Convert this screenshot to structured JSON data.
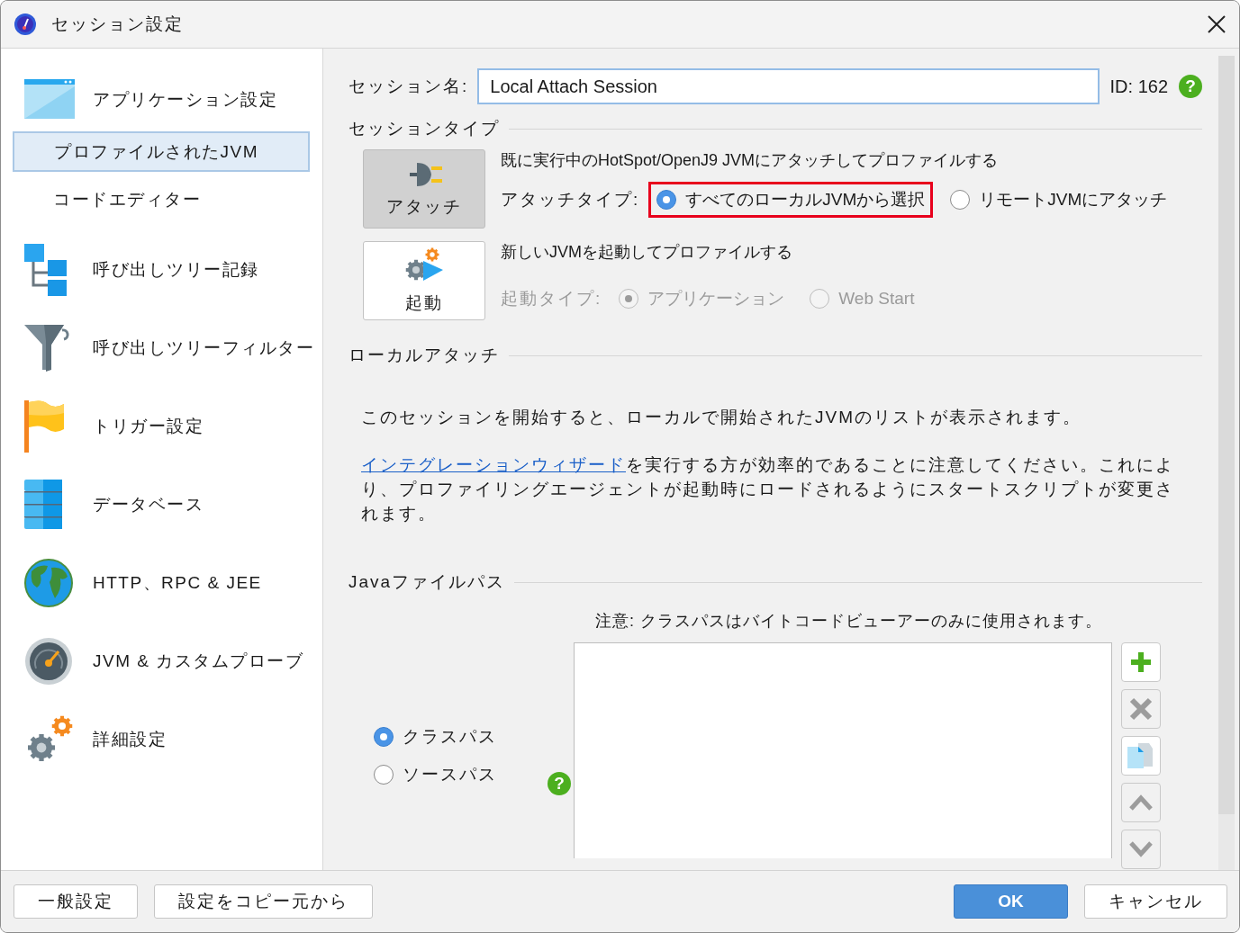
{
  "window": {
    "title": "セッション設定"
  },
  "sidebar": {
    "items": [
      {
        "label": "アプリケーション設定",
        "selected": false,
        "children": [
          {
            "label": "プロファイルされたJVM",
            "selected": true
          },
          {
            "label": "コードエディター",
            "selected": false
          }
        ]
      },
      {
        "label": "呼び出しツリー記録",
        "selected": false
      },
      {
        "label": "呼び出しツリーフィルター",
        "selected": false
      },
      {
        "label": "トリガー設定",
        "selected": false
      },
      {
        "label": "データベース",
        "selected": false
      },
      {
        "label": "HTTP、RPC & JEE",
        "selected": false
      },
      {
        "label": "JVM & カスタムプローブ",
        "selected": false
      },
      {
        "label": "詳細設定",
        "selected": false
      }
    ]
  },
  "session": {
    "name_label": "セッション名:",
    "name_value": "Local Attach Session",
    "id_label": "ID:",
    "id_value": "162",
    "help": "?"
  },
  "session_type": {
    "heading": "セッションタイプ",
    "modes": [
      {
        "kind": "attach",
        "label": "アタッチ",
        "selected": true,
        "description": "既に実行中のHotSpot/OpenJ9 JVMにアタッチしてプロファイルする",
        "type_label": "アタッチタイプ:",
        "disabled": false,
        "options": [
          {
            "label": "すべてのローカルJVMから選択",
            "selected": true,
            "highlighted": true
          },
          {
            "label": "リモートJVMにアタッチ",
            "selected": false,
            "highlighted": false
          }
        ]
      },
      {
        "kind": "launch",
        "label": "起動",
        "selected": false,
        "description": "新しいJVMを起動してプロファイルする",
        "type_label": "起動タイプ:",
        "disabled": true,
        "options": [
          {
            "label": "アプリケーション",
            "selected": true,
            "highlighted": false
          },
          {
            "label": "Web Start",
            "selected": false,
            "highlighted": false
          }
        ]
      }
    ]
  },
  "local_attach": {
    "heading": "ローカルアタッチ",
    "text": "このセッションを開始すると、ローカルで開始されたJVMのリストが表示されます。",
    "link": "インテグレーションウィザード",
    "link_text": "を実行する方が効率的であることに注意してください。これにより、プロファイリングエージェントが起動時にロードされるようにスタートスクリプトが変更されます。"
  },
  "java_file_path": {
    "heading": "Javaファイルパス",
    "note": "注意: クラスパスはバイトコードビューアーのみに使用されます。",
    "options": [
      {
        "label": "クラスパス",
        "selected": true
      },
      {
        "label": "ソースパス",
        "selected": false
      }
    ],
    "help": "?",
    "tools": [
      {
        "kind": "add",
        "disabled": false
      },
      {
        "kind": "remove",
        "disabled": true
      },
      {
        "kind": "copy",
        "disabled": false
      },
      {
        "kind": "up",
        "disabled": true
      },
      {
        "kind": "down",
        "disabled": true
      }
    ]
  },
  "footer": {
    "left_buttons": [
      {
        "label": "一般設定",
        "primary": false
      },
      {
        "label": "設定をコピー元から",
        "primary": false
      }
    ],
    "right_buttons": [
      {
        "label": "OK",
        "primary": true
      },
      {
        "label": "キャンセル",
        "primary": false
      }
    ]
  }
}
